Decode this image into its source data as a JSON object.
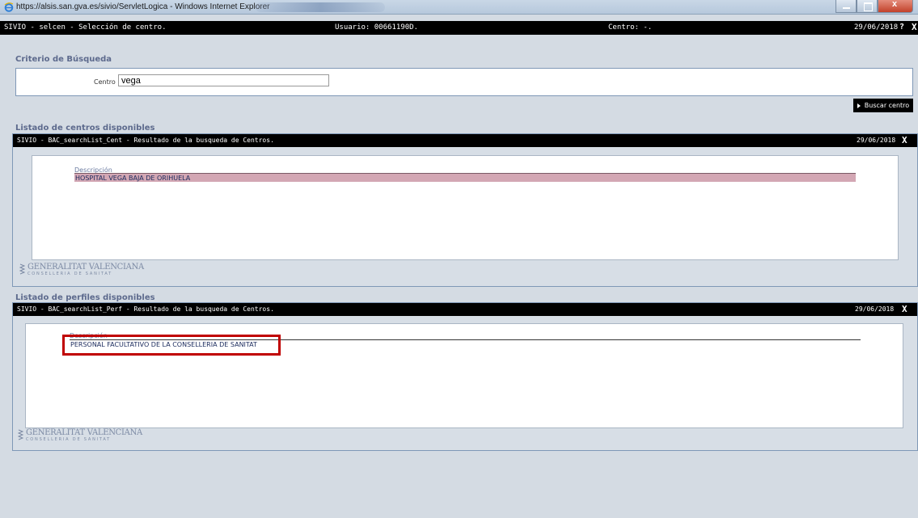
{
  "browser": {
    "window_title": "https://alsis.san.gva.es/sivio/ServletLogica - Windows Internet Explorer"
  },
  "app_header": {
    "title": "SIVIO - selcen - Selección de centro.",
    "usuario": "Usuario: 00661190D.",
    "centro": "Centro: -.",
    "date": "29/06/2018",
    "help": "?",
    "close": "X"
  },
  "search": {
    "section_title": "Criterio de Búsqueda",
    "centro_label": "Centro :",
    "centro_value": "vega",
    "button_label": "Buscar centro"
  },
  "centros": {
    "section_title": "Listado de centros disponibles",
    "header_title": "SIVIO - BAC_searchList_Cent - Resultado de la busqueda de Centros.",
    "date": "29/06/2018",
    "close": "X",
    "column_label": "Descripción",
    "rows": [
      "HOSPITAL VEGA BAJA DE ORIHUELA"
    ]
  },
  "perfiles": {
    "section_title": "Listado de perfiles disponibles",
    "header_title": "SIVIO - BAC_searchList_Perf - Resultado de la busqueda de Centros.",
    "date": "29/06/2018",
    "close": "X",
    "column_label": "Descripción",
    "rows": [
      "PERSONAL FACULTATIVO DE LA CONSELLERIA DE SANITAT"
    ]
  },
  "logo": {
    "main": "GENERALITAT VALENCIANA",
    "sub": "CONSELLERIA DE SANITAT"
  },
  "colors": {
    "section_title": "#5d6a8d",
    "selected_row": "#d3a7b4",
    "highlight_box": "#c00000"
  }
}
